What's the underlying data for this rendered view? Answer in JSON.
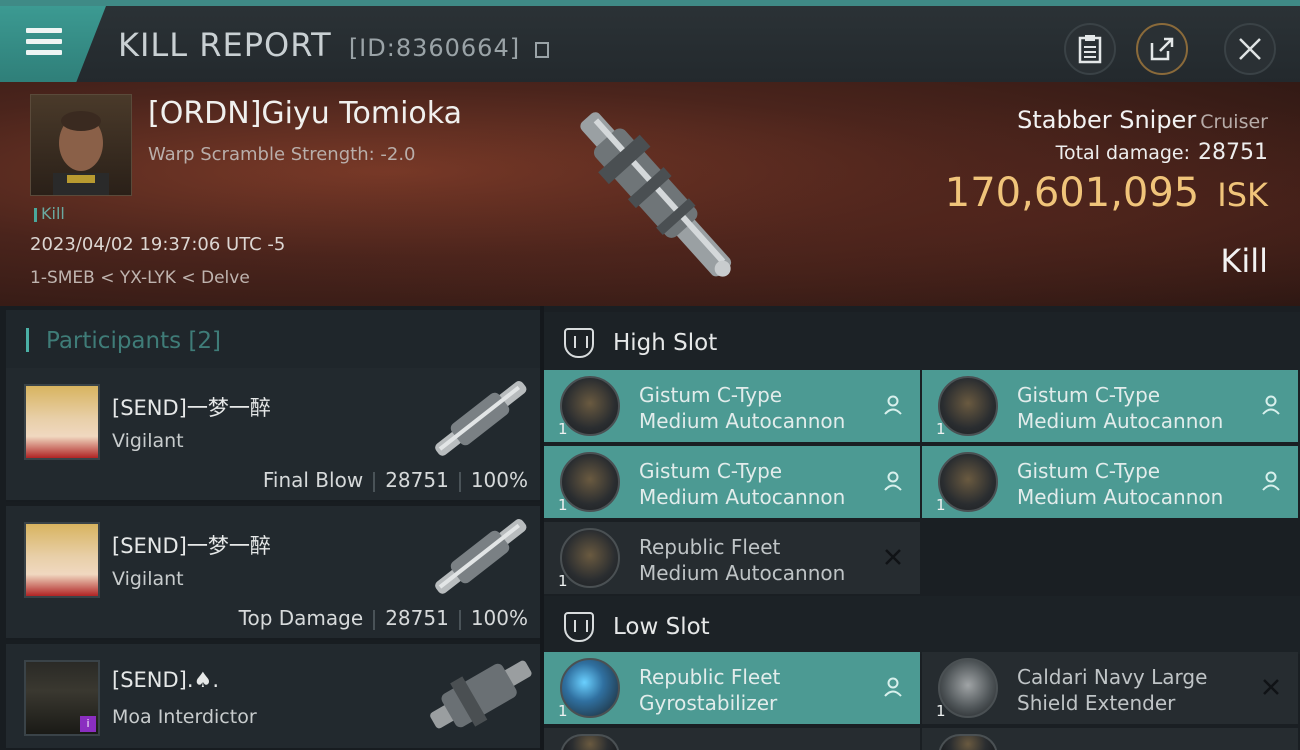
{
  "titlebar": {
    "title": "KILL REPORT",
    "report_id": "[ID:8360664]",
    "menu_icon": "hamburger-icon",
    "actions": [
      "clipboard-icon",
      "share-icon",
      "close-icon"
    ]
  },
  "hero": {
    "pilot": "[ORDN]Giyu Tomioka",
    "scram": "Warp Scramble Strength: -2.0",
    "tag": "Kill",
    "datetime": "2023/04/02 19:37:06 UTC -5",
    "location": "1-SMEB < YX-LYK < Delve",
    "ship_name": "Stabber Sniper",
    "ship_class": "Cruiser",
    "damage_label": "Total damage:",
    "damage_value": "28751",
    "isk_value": "170,601,095",
    "isk_unit": "ISK",
    "result": "Kill"
  },
  "participants": {
    "header": "Participants [2]",
    "rows": [
      {
        "name": "[SEND]一梦一醉",
        "ship": "Vigilant",
        "role": "Final Blow",
        "damage": "28751",
        "percent": "100%"
      },
      {
        "name": "[SEND]一梦一醉",
        "ship": "Vigilant",
        "role": "Top Damage",
        "damage": "28751",
        "percent": "100%"
      },
      {
        "name": "[SEND].♠.",
        "ship": "Moa Interdictor",
        "badge": "i"
      }
    ]
  },
  "slots": {
    "high": {
      "label": "High Slot",
      "modules": [
        {
          "line1": "Gistum C-Type",
          "line2": "Medium Autocannon",
          "qty": "1",
          "status": "fitted"
        },
        {
          "line1": "Gistum C-Type",
          "line2": "Medium Autocannon",
          "qty": "1",
          "status": "fitted"
        },
        {
          "line1": "Gistum C-Type",
          "line2": "Medium Autocannon",
          "qty": "1",
          "status": "fitted"
        },
        {
          "line1": "Gistum C-Type",
          "line2": "Medium Autocannon",
          "qty": "1",
          "status": "fitted"
        },
        {
          "line1": "Republic Fleet",
          "line2": "Medium Autocannon",
          "qty": "1",
          "status": "destroyed"
        }
      ]
    },
    "low": {
      "label": "Low Slot",
      "modules": [
        {
          "line1": "Republic Fleet",
          "line2": "Gyrostabilizer",
          "qty": "1",
          "status": "fitted"
        },
        {
          "line1": "Caldari Navy Large",
          "line2": "Shield Extender",
          "qty": "1",
          "status": "destroyed"
        }
      ]
    }
  },
  "colors": {
    "accent_teal": "#4c9a93",
    "isk_gold": "#f0c47a",
    "hero_red": "#7a3a28"
  }
}
